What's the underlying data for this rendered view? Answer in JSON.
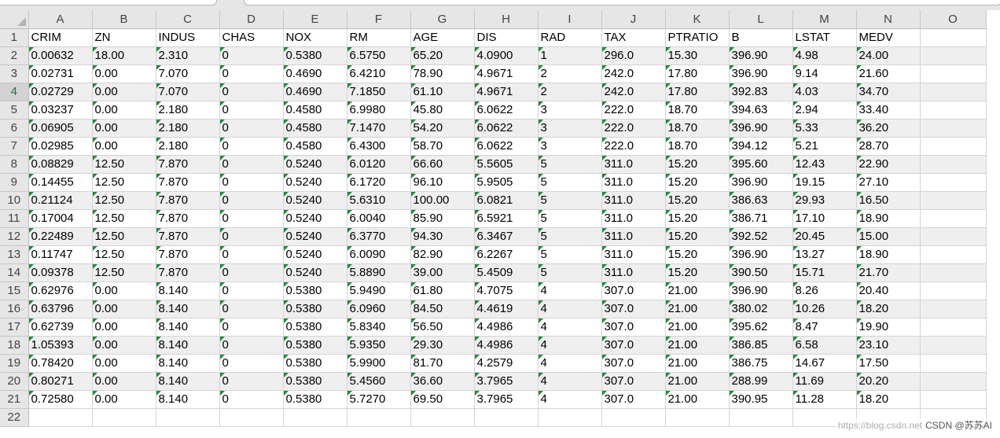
{
  "columns": [
    "A",
    "B",
    "C",
    "D",
    "E",
    "F",
    "G",
    "H",
    "I",
    "J",
    "K",
    "L",
    "M",
    "N",
    "O"
  ],
  "header_row": [
    "CRIM",
    "ZN",
    "INDUS",
    "CHAS",
    "NOX",
    "RM",
    "AGE",
    "DIS",
    "RAD",
    "TAX",
    "PTRATIO",
    "B",
    "LSTAT",
    "MEDV",
    ""
  ],
  "rows": [
    [
      "0.00632",
      "18.00",
      "2.310",
      "0",
      "0.5380",
      "6.5750",
      "65.20",
      "4.0900",
      "1",
      "296.0",
      "15.30",
      "396.90",
      "4.98",
      "24.00",
      ""
    ],
    [
      "0.02731",
      "0.00",
      "7.070",
      "0",
      "0.4690",
      "6.4210",
      "78.90",
      "4.9671",
      "2",
      "242.0",
      "17.80",
      "396.90",
      "9.14",
      "21.60",
      ""
    ],
    [
      "0.02729",
      "0.00",
      "7.070",
      "0",
      "0.4690",
      "7.1850",
      "61.10",
      "4.9671",
      "2",
      "242.0",
      "17.80",
      "392.83",
      "4.03",
      "34.70",
      ""
    ],
    [
      "0.03237",
      "0.00",
      "2.180",
      "0",
      "0.4580",
      "6.9980",
      "45.80",
      "6.0622",
      "3",
      "222.0",
      "18.70",
      "394.63",
      "2.94",
      "33.40",
      ""
    ],
    [
      "0.06905",
      "0.00",
      "2.180",
      "0",
      "0.4580",
      "7.1470",
      "54.20",
      "6.0622",
      "3",
      "222.0",
      "18.70",
      "396.90",
      "5.33",
      "36.20",
      ""
    ],
    [
      "0.02985",
      "0.00",
      "2.180",
      "0",
      "0.4580",
      "6.4300",
      "58.70",
      "6.0622",
      "3",
      "222.0",
      "18.70",
      "394.12",
      "5.21",
      "28.70",
      ""
    ],
    [
      "0.08829",
      "12.50",
      "7.870",
      "0",
      "0.5240",
      "6.0120",
      "66.60",
      "5.5605",
      "5",
      "311.0",
      "15.20",
      "395.60",
      "12.43",
      "22.90",
      ""
    ],
    [
      "0.14455",
      "12.50",
      "7.870",
      "0",
      "0.5240",
      "6.1720",
      "96.10",
      "5.9505",
      "5",
      "311.0",
      "15.20",
      "396.90",
      "19.15",
      "27.10",
      ""
    ],
    [
      "0.21124",
      "12.50",
      "7.870",
      "0",
      "0.5240",
      "5.6310",
      "100.00",
      "6.0821",
      "5",
      "311.0",
      "15.20",
      "386.63",
      "29.93",
      "16.50",
      ""
    ],
    [
      "0.17004",
      "12.50",
      "7.870",
      "0",
      "0.5240",
      "6.0040",
      "85.90",
      "6.5921",
      "5",
      "311.0",
      "15.20",
      "386.71",
      "17.10",
      "18.90",
      ""
    ],
    [
      "0.22489",
      "12.50",
      "7.870",
      "0",
      "0.5240",
      "6.3770",
      "94.30",
      "6.3467",
      "5",
      "311.0",
      "15.20",
      "392.52",
      "20.45",
      "15.00",
      ""
    ],
    [
      "0.11747",
      "12.50",
      "7.870",
      "0",
      "0.5240",
      "6.0090",
      "82.90",
      "6.2267",
      "5",
      "311.0",
      "15.20",
      "396.90",
      "13.27",
      "18.90",
      ""
    ],
    [
      "0.09378",
      "12.50",
      "7.870",
      "0",
      "0.5240",
      "5.8890",
      "39.00",
      "5.4509",
      "5",
      "311.0",
      "15.20",
      "390.50",
      "15.71",
      "21.70",
      ""
    ],
    [
      "0.62976",
      "0.00",
      "8.140",
      "0",
      "0.5380",
      "5.9490",
      "61.80",
      "4.7075",
      "4",
      "307.0",
      "21.00",
      "396.90",
      "8.26",
      "20.40",
      ""
    ],
    [
      "0.63796",
      "0.00",
      "8.140",
      "0",
      "0.5380",
      "6.0960",
      "84.50",
      "4.4619",
      "4",
      "307.0",
      "21.00",
      "380.02",
      "10.26",
      "18.20",
      ""
    ],
    [
      "0.62739",
      "0.00",
      "8.140",
      "0",
      "0.5380",
      "5.8340",
      "56.50",
      "4.4986",
      "4",
      "307.0",
      "21.00",
      "395.62",
      "8.47",
      "19.90",
      ""
    ],
    [
      "1.05393",
      "0.00",
      "8.140",
      "0",
      "0.5380",
      "5.9350",
      "29.30",
      "4.4986",
      "4",
      "307.0",
      "21.00",
      "386.85",
      "6.58",
      "23.10",
      ""
    ],
    [
      "0.78420",
      "0.00",
      "8.140",
      "0",
      "0.5380",
      "5.9900",
      "81.70",
      "4.2579",
      "4",
      "307.0",
      "21.00",
      "386.75",
      "14.67",
      "17.50",
      ""
    ],
    [
      "0.80271",
      "0.00",
      "8.140",
      "0",
      "0.5380",
      "5.4560",
      "36.60",
      "3.7965",
      "4",
      "307.0",
      "21.00",
      "288.99",
      "11.69",
      "20.20",
      ""
    ],
    [
      "0.72580",
      "0.00",
      "8.140",
      "0",
      "0.5380",
      "5.7270",
      "69.50",
      "3.7965",
      "4",
      "307.0",
      "21.00",
      "390.95",
      "11.28",
      "18.20",
      ""
    ]
  ],
  "active_row": 4,
  "extra_row_number": "22",
  "watermark": {
    "faint": "https://blog.csdn.net",
    "text": "CSDN @苏苏AI"
  },
  "colors": {
    "header_bg": "#e6e6e6",
    "shade_row": "#efefef",
    "error_triangle": "#1f8a3b",
    "active_row_number": "#217346"
  }
}
